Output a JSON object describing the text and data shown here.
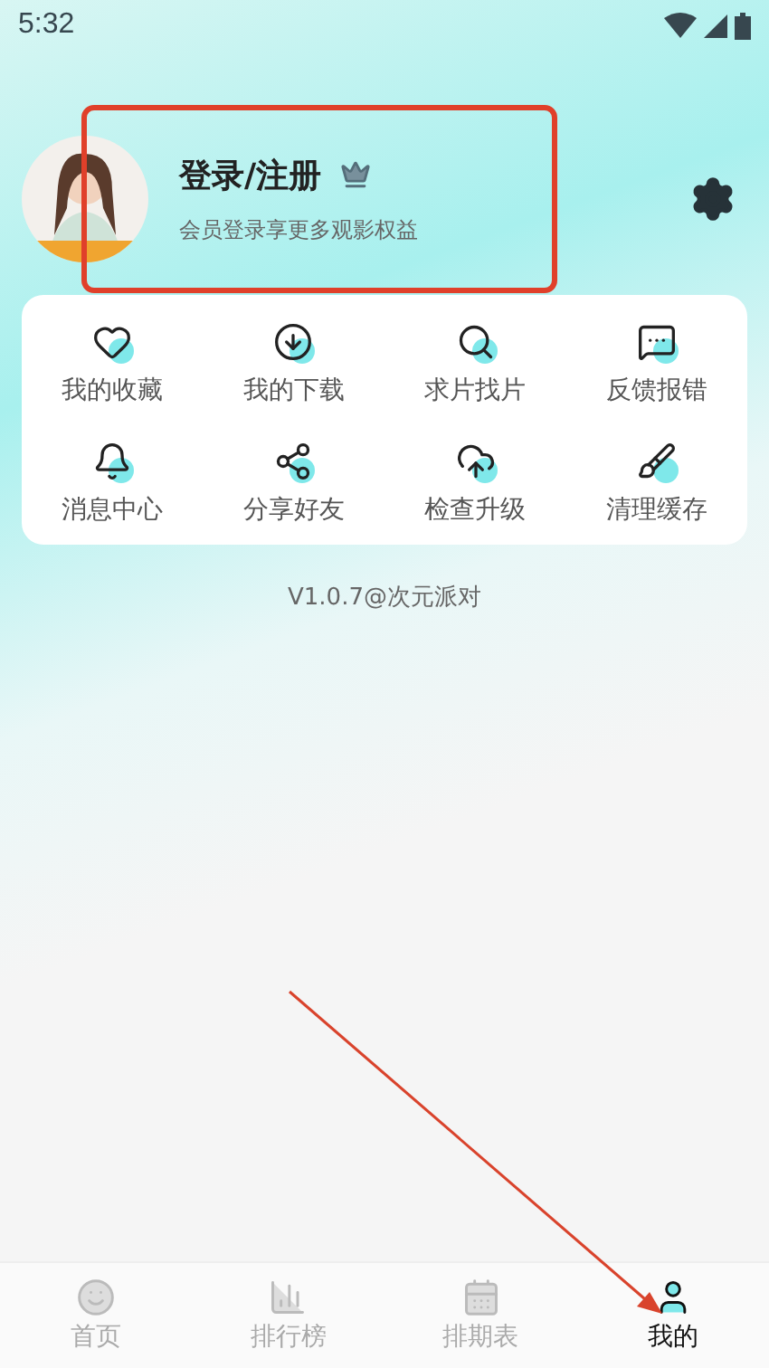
{
  "status_bar": {
    "time": "5:32"
  },
  "profile": {
    "title": "登录/注册",
    "subtitle": "会员登录享更多观影权益"
  },
  "menu": [
    {
      "label": "我的收藏"
    },
    {
      "label": "我的下载"
    },
    {
      "label": "求片找片"
    },
    {
      "label": "反馈报错"
    },
    {
      "label": "消息中心"
    },
    {
      "label": "分享好友"
    },
    {
      "label": "检查升级"
    },
    {
      "label": "清理缓存"
    }
  ],
  "version": "V1.0.7@次元派对",
  "tabs": [
    {
      "label": "首页",
      "selected": false
    },
    {
      "label": "排行榜",
      "selected": false
    },
    {
      "label": "排期表",
      "selected": false
    },
    {
      "label": "我的",
      "selected": true
    }
  ]
}
